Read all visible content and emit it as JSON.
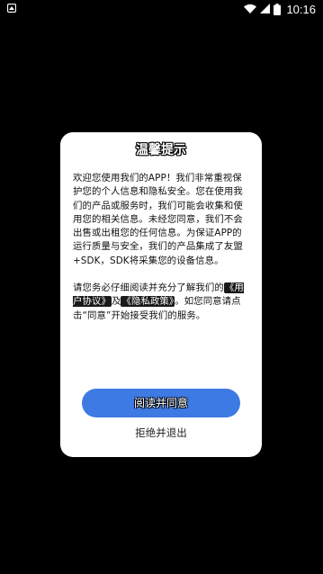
{
  "status_bar": {
    "time": "10:16",
    "app_icon": "app-notification-icon",
    "wifi_icon": "wifi-icon",
    "signal_icon": "cell-signal-icon",
    "battery_icon": "battery-icon"
  },
  "dialog": {
    "title": "温馨提示",
    "para1": "欢迎您使用我们的APP！我们非常重视保护您的个人信息和隐私安全。您在使用我们的产品或服务时，我们可能会收集和使用您的相关信息。未经您同意，我们不会出售或出租您的任何信息。为保证APP的运行质量与安全，我们的产品集成了友盟+SDK，SDK将采集您的设备信息。",
    "para2_prefix": "请您务必仔细阅读并充分了解我们的",
    "user_agreement": "《用户协议》",
    "and_text": "及",
    "privacy_policy": "《隐私政策》",
    "para2_suffix": "。如您同意请点击“同意”开始接受我们的服务。",
    "agree_label": "阅读并同意",
    "decline_label": "拒绝并退出"
  },
  "colors": {
    "overlay": "#000000",
    "dialog_bg": "#ffffff",
    "button_bg": "#3e7ae3",
    "highlight_bg": "#1a1a1a"
  }
}
